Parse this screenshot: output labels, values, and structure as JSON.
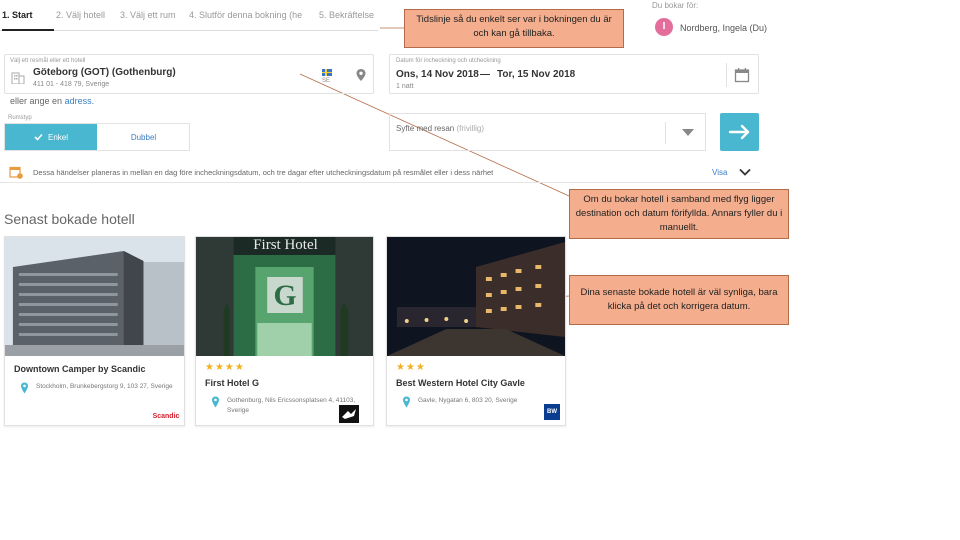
{
  "steps": [
    {
      "label": "1. Start"
    },
    {
      "label": "2. Välj hotell"
    },
    {
      "label": "3. Välj ett rum"
    },
    {
      "label": "4. Slutför denna bokning (he"
    },
    {
      "label": "5. Bekräftelse"
    }
  ],
  "user": {
    "booking_for_label": "Du bokar för:",
    "initial": "I",
    "name": "Nordberg, Ingela (Du)"
  },
  "callouts": {
    "timeline": "Tidslinje så du enkelt ser var i bokningen du är och kan gå tillbaka.",
    "flight": "Om du bokar hotell i samband med flyg ligger destination och datum förifyllda. Annars fyller du i manuellt.",
    "recent": "Dina senaste bokade hotell är väl synliga, bara klicka på det och korrigera datum."
  },
  "destination": {
    "label": "Välj ett resmål eller ett hotell",
    "name": "Göteborg (GOT) (Gothenburg)",
    "address": "411 01 - 418 79, Sverige",
    "country_code": "SE",
    "hint_prefix": "eller ange en",
    "hint_link": "adress."
  },
  "dates": {
    "label": "Datum för incheckning och utcheckning",
    "checkin": "Ons, 14 Nov 2018",
    "separator": "—",
    "checkout": "Tor, 15 Nov 2018",
    "nights": "1 natt"
  },
  "room_type": {
    "label": "Rumstyp",
    "single": "Enkel",
    "double": "Dubbel"
  },
  "purpose": {
    "text": "Syfte med resan",
    "optional": "(frivillig)"
  },
  "info": {
    "text": "Dessa händelser planeras in mellan en dag före incheckningsdatum, och tre dagar efter utcheckningsdatum på resmålet eller i dess närhet",
    "link": "Visa"
  },
  "recent_title": "Senast bokade hotell",
  "hotels": [
    {
      "name": "Downtown Camper by Scandic",
      "stars": "",
      "address": "Stockholm, Brunkebergstorg 9, 103 27, Sverige",
      "logo": "Scandic"
    },
    {
      "name": "First Hotel G",
      "stars": "★★★★",
      "address": "Gothenburg, Nils Ericssonsplatsen 4, 41103, Sverige",
      "sign": "First Hotel"
    },
    {
      "name": "Best Western Hotel City Gavle",
      "stars": "★★★",
      "address": "Gavle, Nygatan 6, 803 20, Sverige",
      "logo": "Best Western"
    }
  ],
  "colors": {
    "accent": "#48b7cf",
    "callout_bg": "#f4ae8e",
    "avatar": "#e46e9b",
    "link": "#3a7fc1",
    "star": "#f2b01e"
  }
}
